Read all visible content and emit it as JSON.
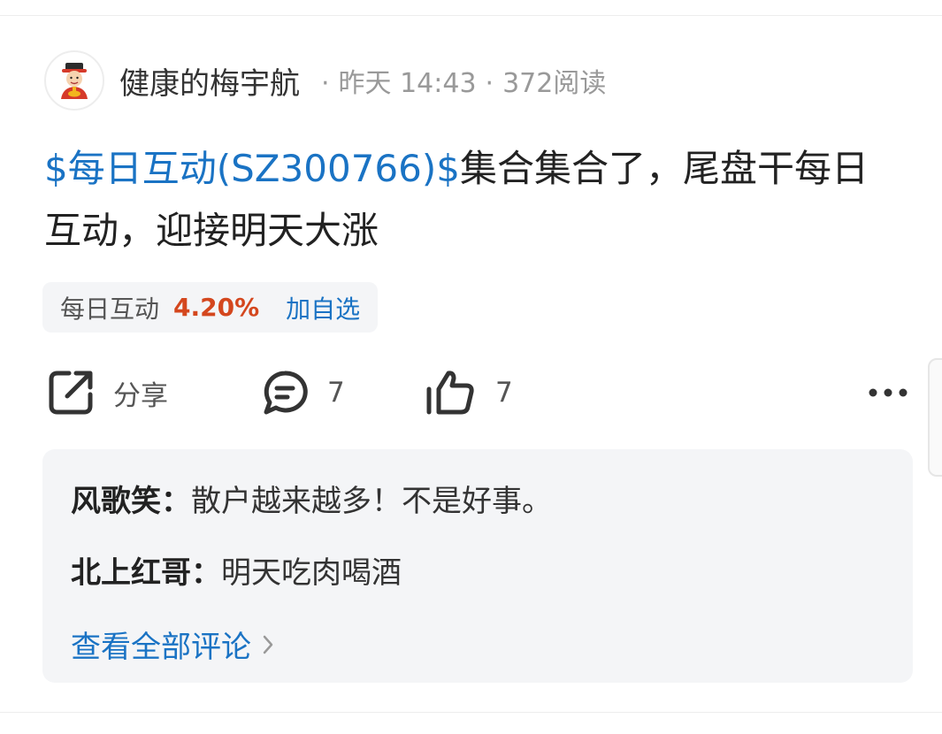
{
  "post": {
    "author": "健康的梅宇航",
    "time": "昨天 14:43",
    "reads": "372阅读",
    "ticker": "$每日互动(SZ300766)$",
    "body": "集合集合了，尾盘干每日互动，迎接明天大涨"
  },
  "stock": {
    "name": "每日互动",
    "change": "4.20%",
    "add_label": "加自选"
  },
  "actions": {
    "share_label": "分享",
    "comment_count": "7",
    "like_count": "7"
  },
  "comments": [
    {
      "user": "风歌笑",
      "text": "散户越来越多！不是好事。"
    },
    {
      "user": "北上红哥",
      "text": "明天吃肉喝酒"
    }
  ],
  "view_all": "查看全部评论",
  "colors": {
    "link": "#1a73c4",
    "up": "#d4471e",
    "chip_bg": "#f4f5f7"
  },
  "icons": [
    "avatar-caishen-icon",
    "share-icon",
    "comment-icon",
    "like-icon",
    "more-icon",
    "chevron-right-icon"
  ]
}
